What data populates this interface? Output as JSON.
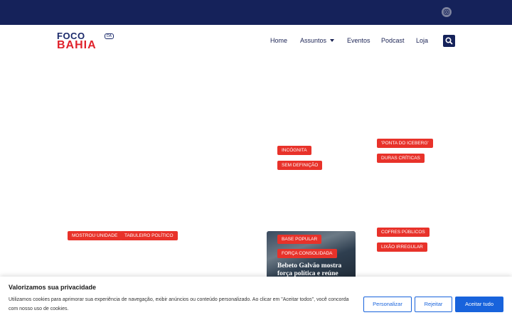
{
  "topbar": {
    "social_icon": "instagram-icon"
  },
  "logo": {
    "line1": "FOCO",
    "badge": "DA",
    "line2": "BAHIA"
  },
  "nav": {
    "home": "Home",
    "assuntos": "Assuntos",
    "eventos": "Eventos",
    "podcast": "Podcast",
    "loja": "Loja",
    "search_icon": "search-icon"
  },
  "tags": {
    "incognita": "INCÓGNITA",
    "sem_definicao": "SEM DEFINIÇÃO",
    "ponta_iceberg": "'PONTA DO ICEBERG'",
    "duras_criticas": "DURAS CRÍTICAS",
    "mostrou_unidade": "MOSTROU UNIDADE",
    "tabuleiro_politico": "TABULEIRO POLÍTICO",
    "base_popular": "BASE POPULAR",
    "forca_consolidada": "FORÇA CONSOLIDADA",
    "cofres_publicos": "COFRES PÚBLICOS",
    "lixao_irregular": "LIXÃO IRREGULAR"
  },
  "featured": {
    "headline": "Bebeto Galvão mostra força política e reúne"
  },
  "cookie": {
    "title": "Valorizamos sua privacidade",
    "text": "Utilizamos cookies para aprimorar sua experiência de navegação, exibir anúncios ou conteúdo personalizado. Ao clicar em \"Aceitar todos\", você concorda com nosso uso de cookies.",
    "customize": "Personalizar",
    "reject": "Rejeitar",
    "accept": "Aceitar tudo"
  },
  "colors": {
    "navy": "#15225a",
    "red": "#e8322a",
    "blue": "#1863dc"
  }
}
